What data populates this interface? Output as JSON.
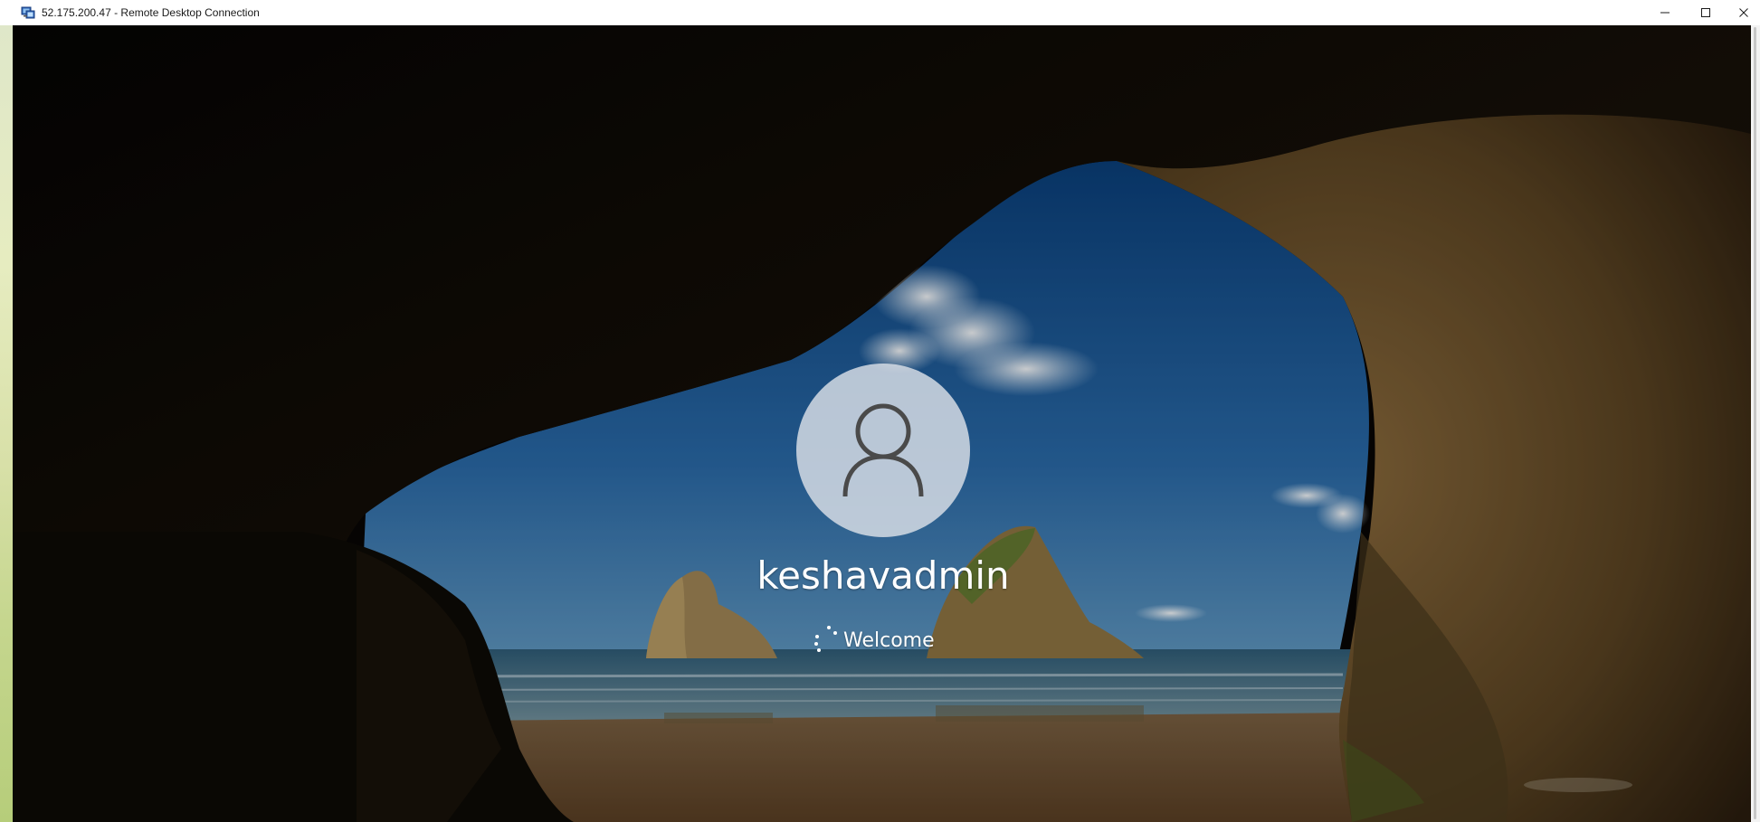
{
  "window": {
    "title": "52.175.200.47 - Remote Desktop Connection",
    "app_icon": "remote-desktop-icon",
    "controls": {
      "minimize_icon": "minimize-icon",
      "maximize_icon": "maximize-icon",
      "close_icon": "close-icon"
    }
  },
  "login_screen": {
    "avatar_icon": "user-icon",
    "username": "keshavadmin",
    "status_text": "Welcome",
    "spinner_icon": "loading-spinner-icon"
  },
  "colors": {
    "titlebar_bg": "#ffffff",
    "title_text": "#1a1a1a",
    "text_on_lockscreen": "#ffffff",
    "avatar_bg": "#dce1e8"
  }
}
